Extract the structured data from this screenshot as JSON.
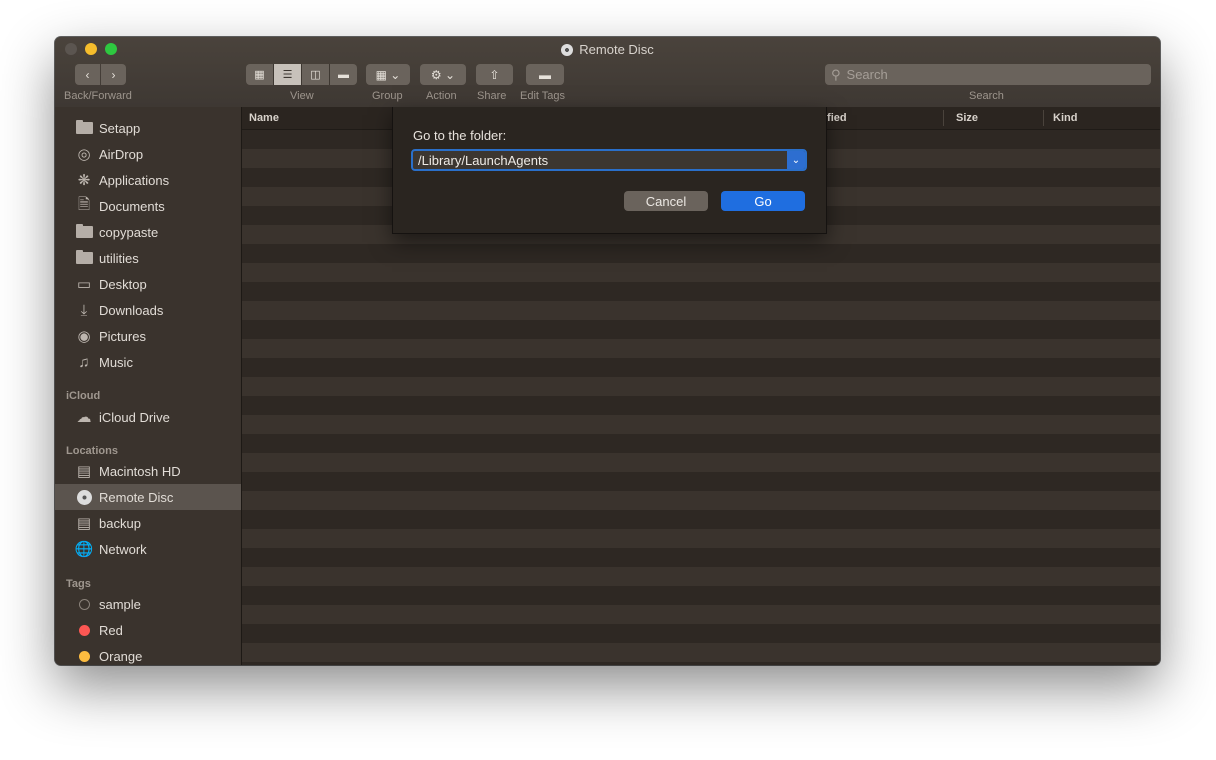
{
  "window": {
    "title": "Remote Disc"
  },
  "toolbar": {
    "back_forward_label": "Back/Forward",
    "view_label": "View",
    "group_label": "Group",
    "action_label": "Action",
    "share_label": "Share",
    "edit_tags_label": "Edit Tags",
    "search_placeholder": "Search",
    "search_label": "Search"
  },
  "sidebar": {
    "favorites": [
      {
        "label": "Setapp",
        "icon": "folder-icon"
      },
      {
        "label": "AirDrop",
        "icon": "airdrop-icon"
      },
      {
        "label": "Applications",
        "icon": "applications-icon"
      },
      {
        "label": "Documents",
        "icon": "documents-icon"
      },
      {
        "label": "copypaste",
        "icon": "folder-icon"
      },
      {
        "label": "utilities",
        "icon": "folder-icon"
      },
      {
        "label": "Desktop",
        "icon": "desktop-icon"
      },
      {
        "label": "Downloads",
        "icon": "downloads-icon"
      },
      {
        "label": "Pictures",
        "icon": "camera-icon"
      },
      {
        "label": "Music",
        "icon": "music-icon"
      }
    ],
    "icloud_header": "iCloud",
    "icloud": [
      {
        "label": "iCloud Drive",
        "icon": "cloud-icon"
      }
    ],
    "locations_header": "Locations",
    "locations": [
      {
        "label": "Macintosh HD",
        "icon": "harddisk-icon"
      },
      {
        "label": "Remote Disc",
        "icon": "disc-icon",
        "selected": true
      },
      {
        "label": "backup",
        "icon": "drive-icon"
      },
      {
        "label": "Network",
        "icon": "network-icon"
      }
    ],
    "tags_header": "Tags",
    "tags": [
      {
        "label": "sample",
        "color": "#3a332d"
      },
      {
        "label": "Red",
        "color": "#fc5753"
      },
      {
        "label": "Orange",
        "color": "#fdbc40"
      }
    ]
  },
  "columns": {
    "name": "Name",
    "modified": "ified",
    "size": "Size",
    "kind": "Kind"
  },
  "dialog": {
    "title": "Go to the folder:",
    "path_value": "/Library/LaunchAgents",
    "cancel_label": "Cancel",
    "go_label": "Go"
  },
  "colors": {
    "accent": "#1f6ee0",
    "window_bg": "#2b2520",
    "sidebar_bg": "#3a332d"
  }
}
